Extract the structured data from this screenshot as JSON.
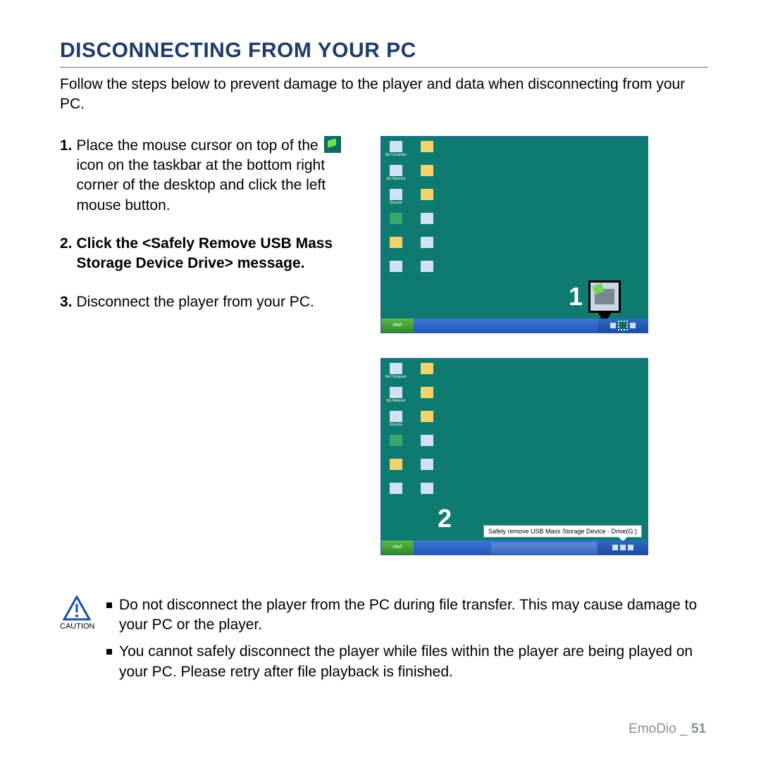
{
  "title": "DISCONNECTING FROM YOUR PC",
  "intro": "Follow the steps below to prevent damage to the player and data when disconnecting from your PC.",
  "steps": {
    "s1": {
      "num": "1.",
      "before": "Place the mouse cursor on top of the",
      "after": "icon on the taskbar at the bottom right corner of the desktop and click the left mouse button."
    },
    "s2": {
      "num": "2.",
      "pre": "Click the ",
      "bold": "<Safely Remove USB Mass Storage Device Drive>",
      "post": " message."
    },
    "s3": {
      "num": "3.",
      "text": "Disconnect the player from your PC."
    }
  },
  "callouts": {
    "one": "1",
    "two": "2"
  },
  "balloon": "Safely remove USB Mass Storage Device - Drive(G:)",
  "start_label": "start",
  "caution_label": "CAUTION",
  "cautions": {
    "c1": "Do not disconnect the player from the PC during file transfer. This may cause damage to your PC or the player.",
    "c2": "You cannot safely disconnect the player while files within the player are being played on your PC. Please retry after file playback is finished."
  },
  "footer": {
    "section": "EmoDio",
    "sep": "_",
    "page": "51"
  }
}
